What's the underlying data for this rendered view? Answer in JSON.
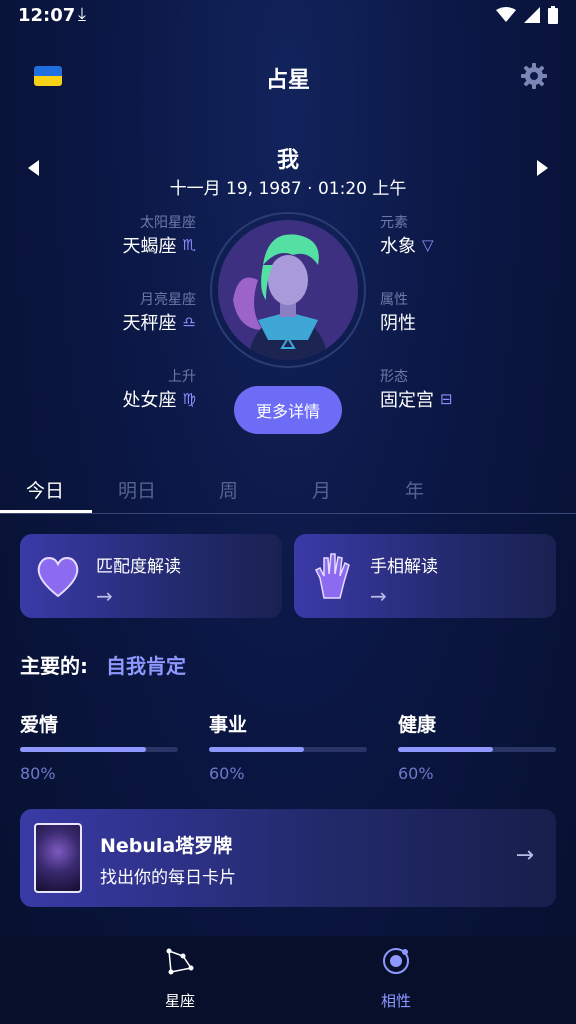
{
  "status_bar": {
    "time": "12:07"
  },
  "header": {
    "title": "占星"
  },
  "profile": {
    "name": "我",
    "dob": "十一月 19, 1987 · 01:20 上午",
    "sun": {
      "label": "太阳星座",
      "value": "天蝎座",
      "symbol": "♏"
    },
    "moon": {
      "label": "月亮星座",
      "value": "天秤座",
      "symbol": "♎"
    },
    "rising": {
      "label": "上升",
      "value": "处女座",
      "symbol": "♍"
    },
    "element": {
      "label": "元素",
      "value": "水象",
      "symbol": "▽"
    },
    "quality": {
      "label": "属性",
      "value": "阴性"
    },
    "modality": {
      "label": "形态",
      "value": "固定宫",
      "symbol": "⊟"
    },
    "more_button": "更多详情"
  },
  "tabs": [
    "今日",
    "明日",
    "周",
    "月",
    "年"
  ],
  "cards": [
    {
      "title": "匹配度解读",
      "arrow": "→",
      "icon": "heart-icon"
    },
    {
      "title": "手相解读",
      "arrow": "→",
      "icon": "palm-icon"
    }
  ],
  "main": {
    "label": "主要的:",
    "value": "自我肯定"
  },
  "stats": [
    {
      "title": "爱情",
      "percent_label": "80%",
      "value": 0.8
    },
    {
      "title": "事业",
      "percent_label": "60%",
      "value": 0.6
    },
    {
      "title": "健康",
      "percent_label": "60%",
      "value": 0.6
    }
  ],
  "tarot": {
    "title": "Nebula塔罗牌",
    "subtitle": "找出你的每日卡片",
    "arrow": "→"
  },
  "bottom_nav": [
    {
      "label": "星座",
      "icon": "constellation-icon"
    },
    {
      "label": "相性",
      "icon": "orbit-icon"
    }
  ],
  "colors": {
    "accent": "#6d6cf6",
    "progress": "#8f98ff",
    "background": "#0b1744"
  }
}
